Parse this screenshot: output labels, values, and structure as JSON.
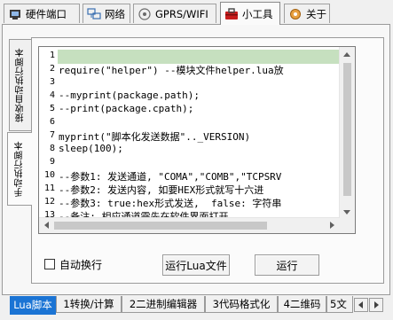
{
  "top_tabs": [
    {
      "label": "硬件端口",
      "icon": "hardware-port-icon"
    },
    {
      "label": "网络",
      "icon": "network-icon"
    },
    {
      "label": "GPRS/WIFI",
      "icon": "gprs-wifi-icon"
    },
    {
      "label": "小工具",
      "icon": "toolbox-icon"
    },
    {
      "label": "关于",
      "icon": "about-gear-icon"
    }
  ],
  "left_tabs": [
    {
      "label": "接收自动执行脚本"
    },
    {
      "label": "手动执行脚本"
    }
  ],
  "editor": {
    "line_numbers": [
      "1",
      "2",
      "3",
      "4",
      "5",
      "6",
      "7",
      "8",
      "9",
      "10",
      "11",
      "12",
      "13"
    ],
    "lines": [
      "",
      "require(\"helper\") --模块文件helper.lua放",
      "",
      "--myprint(package.path);",
      "--print(package.cpath);",
      "",
      "myprint(\"脚本化发送数据\".._VERSION)",
      "sleep(100);",
      "",
      "--参数1: 发送通道, \"COMA\",\"COMB\",\"TCPSRV",
      "--参数2: 发送内容, 如要HEX形式就写十六进",
      "--参数3: true:hex形式发送,  false: 字符串",
      "--备注: 相应通道需先在软件界面打开"
    ]
  },
  "auto_wrap_label": "自动换行",
  "run_lua_file_label": "运行Lua文件",
  "run_label": "运行",
  "bottom_tabs": [
    {
      "label": "Lua脚本"
    },
    {
      "label": "1转换/计算"
    },
    {
      "label": "2二进制编辑器"
    },
    {
      "label": "3代码格式化"
    },
    {
      "label": "4二维码"
    },
    {
      "label": "5文"
    }
  ],
  "colors": {
    "active_bottom_tab": "#1b74d4",
    "current_line": "#c6e0bf"
  }
}
